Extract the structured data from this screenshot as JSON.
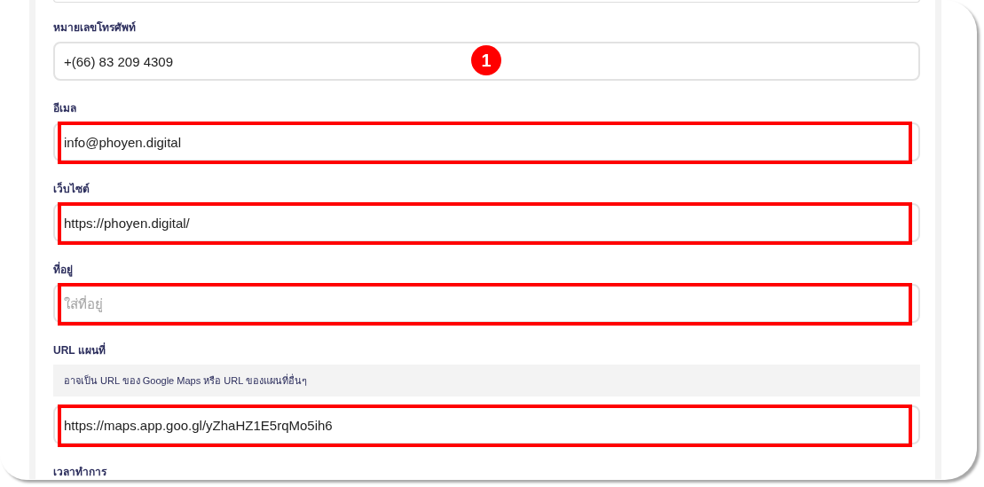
{
  "fields": [
    {
      "label": "หมายเลขโทรศัพท์",
      "value": "+(66) 83 209 4309",
      "highlighted": false,
      "badge": "1"
    },
    {
      "label": "อีเมล",
      "value": "info@phoyen.digital",
      "highlighted": true
    },
    {
      "label": "เว็บไซต์",
      "value": "https://phoyen.digital/",
      "highlighted": true
    },
    {
      "label": "ที่อยู่",
      "placeholder": "ใส่ที่อยู่",
      "highlighted": true
    },
    {
      "label": "URL แผนที่",
      "help": "อาจเป็น URL ของ Google Maps หรือ URL ของแผนที่อื่นๆ",
      "value": "https://maps.app.goo.gl/yZhaHZ1E5rqMo5ih6",
      "highlighted": true
    }
  ],
  "next_label": "เวลาทำการ"
}
